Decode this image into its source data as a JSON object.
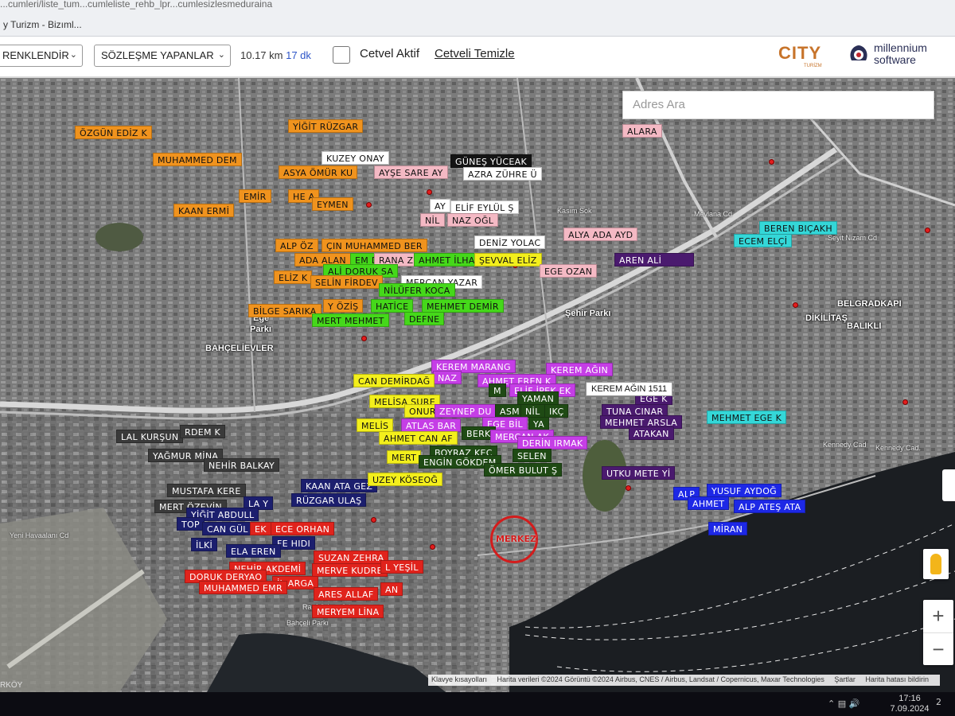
{
  "browser": {
    "url_fragment": "...cumleri/liste_tum...cumleliste_rehb_lpr...cumlesizlesmeduraina",
    "tab_title": "y Turizm - Bizıml..."
  },
  "toolbar": {
    "color_select": "RENKLENDİR",
    "filter_select": "SÖZLEŞME YAPANLAR",
    "distance": "10.17 km",
    "duration": "17 dk",
    "ruler_label": "Cetvel Aktif",
    "ruler_clear": "Cetveli Temizle",
    "logo_city": "CITY",
    "logo_city_sub": "TURİZM",
    "logo_ms_1": "millennium",
    "logo_ms_2": "software"
  },
  "map": {
    "search_placeholder": "Adres Ara",
    "merkez_label": "MERKEZ",
    "tooltip": "KEREM AĞIN 1511",
    "zoom_in": "+",
    "zoom_out": "−",
    "attribution": [
      "Klavye kısayolları",
      "Harita verileri ©2024 Görüntü ©2024 Airbus, CNES / Airbus, Landsat / Copernicus, Maxar Technologies",
      "Şartlar",
      "Harita hatası bildirin"
    ],
    "bottom_left": "RKÖY",
    "places": [
      {
        "id": "dikilitas",
        "text": "DİKİLİTAŞ"
      },
      {
        "id": "belgrad",
        "text": "BELGRADKAPI"
      },
      {
        "id": "balikli",
        "text": "BALIKLI"
      },
      {
        "id": "bahcelievler",
        "text": "BAHÇELİEVLER"
      },
      {
        "id": "sehirparki",
        "text": "Şehir Parkı"
      },
      {
        "id": "ege",
        "text": "Ege"
      },
      {
        "id": "parki",
        "text": "Parkı"
      }
    ],
    "streets": [
      {
        "id": "s1",
        "text": "Kasım Sok"
      },
      {
        "id": "s2",
        "text": "Mevlana Cd"
      },
      {
        "id": "s3",
        "text": "Seyit Nizam Cd"
      },
      {
        "id": "s4",
        "text": "Kennedy Cad"
      },
      {
        "id": "s5",
        "text": "Kennedy Cad."
      },
      {
        "id": "s6",
        "text": "Yeni Havaalanı Cd"
      },
      {
        "id": "s7",
        "text": "Rauf Orbay Cd"
      },
      {
        "id": "s8",
        "text": "Bahçeli Parkı"
      }
    ]
  },
  "colors": {
    "orange": "#f0931e",
    "yellow": "#f3ef1c",
    "green": "#45d81a",
    "magenta": "#c53ee6",
    "purple": "#4a1a6e",
    "darkgreen": "#1f4a14",
    "gray": "#3a3a3a",
    "navy": "#1c1f6e",
    "red": "#e0231c",
    "cyan": "#34d7d8",
    "blue": "#1d28e6",
    "pink": "#f4b9c4",
    "white": "#ffffff",
    "black": "#141414",
    "yellow2": "#e8e018"
  },
  "labels": [
    {
      "t": "ÖZGÜN EDİZ K",
      "c": "orange",
      "fg": "#111"
    },
    {
      "t": "YİĞİT RÜZGAR",
      "c": "orange",
      "fg": "#111"
    },
    {
      "t": "MUHAMMED DEM",
      "c": "orange",
      "fg": "#111"
    },
    {
      "t": "KUZEY ONAY",
      "c": "white",
      "fg": "#111"
    },
    {
      "t": "GÜNEŞ YÜCEAK",
      "c": "black",
      "fg": "#fff"
    },
    {
      "t": "ASYA ÖMÜR KU",
      "c": "orange",
      "fg": "#111"
    },
    {
      "t": "AYŞE SARE AY",
      "c": "pink",
      "fg": "#111"
    },
    {
      "t": "AZRA ZÜHRE Ü",
      "c": "white",
      "fg": "#111"
    },
    {
      "t": "EMİR",
      "c": "orange",
      "fg": "#111"
    },
    {
      "t": "HE   A",
      "c": "orange",
      "fg": "#111"
    },
    {
      "t": "EYMEN",
      "c": "orange",
      "fg": "#111"
    },
    {
      "t": "AY",
      "c": "white",
      "fg": "#111"
    },
    {
      "t": "ELİF EYLÜL Ş",
      "c": "white",
      "fg": "#111"
    },
    {
      "t": "KAAN ERMİ",
      "c": "orange",
      "fg": "#111"
    },
    {
      "t": "NİL",
      "c": "pink",
      "fg": "#111"
    },
    {
      "t": "NAZ  OĞL",
      "c": "pink",
      "fg": "#111"
    },
    {
      "t": "ALARA",
      "c": "pink",
      "fg": "#111"
    },
    {
      "t": "ALYA ADA AYD",
      "c": "pink",
      "fg": "#111"
    },
    {
      "t": "ALP ÖZ",
      "c": "orange",
      "fg": "#111"
    },
    {
      "t": "ÇIN MUHAMMED BER",
      "c": "orange",
      "fg": "#111"
    },
    {
      "t": "DENİZ YOLAC",
      "c": "white",
      "fg": "#111"
    },
    {
      "t": "ADA ALAN",
      "c": "orange",
      "fg": "#111"
    },
    {
      "t": "EM D",
      "c": "green",
      "fg": "#111"
    },
    {
      "t": "RANA Z",
      "c": "pink",
      "fg": "#111"
    },
    {
      "t": "AHMET İLHA",
      "c": "green",
      "fg": "#111"
    },
    {
      "t": "ŞEVVAL ELİZ",
      "c": "yellow",
      "fg": "#111"
    },
    {
      "t": "ALİ DORUK SA",
      "c": "green",
      "fg": "#111"
    },
    {
      "t": "EGE OZAN",
      "c": "pink",
      "fg": "#111"
    },
    {
      "t": "AREN ALİ",
      "c": "purple",
      "fg": "#fff"
    },
    {
      "t": "ELİZ K",
      "c": "orange",
      "fg": "#111"
    },
    {
      "t": "SELİN FİRDEV",
      "c": "orange",
      "fg": "#111"
    },
    {
      "t": "MERCAN YAZAR",
      "c": "white",
      "fg": "#111"
    },
    {
      "t": "NİLÜFER KOCA",
      "c": "green",
      "fg": "#111"
    },
    {
      "t": "BİLGE SARIKA",
      "c": "orange",
      "fg": "#111"
    },
    {
      "t": "Y ÖZİŞ",
      "c": "orange",
      "fg": "#111"
    },
    {
      "t": "HATİCE",
      "c": "green",
      "fg": "#111"
    },
    {
      "t": "MEHMET DEMİR",
      "c": "green",
      "fg": "#111"
    },
    {
      "t": "MERT MEHMET",
      "c": "green",
      "fg": "#111"
    },
    {
      "t": "DEFNE",
      "c": "green",
      "fg": "#111"
    },
    {
      "t": "BEREN BIÇAKH",
      "c": "cyan",
      "fg": "#111"
    },
    {
      "t": "ECEM ELÇİ",
      "c": "cyan",
      "fg": "#111"
    },
    {
      "t": "KEREM MARANG",
      "c": "magenta",
      "fg": "#fff"
    },
    {
      "t": "NAZ",
      "c": "magenta",
      "fg": "#fff"
    },
    {
      "t": "KEREM AĞIN",
      "c": "magenta",
      "fg": "#fff"
    },
    {
      "t": "CAN DEMİRDAĞ",
      "c": "yellow",
      "fg": "#111"
    },
    {
      "t": "AHMET EREN K",
      "c": "magenta",
      "fg": "#fff"
    },
    {
      "t": "ELİF İPEK EK",
      "c": "magenta",
      "fg": "#fff"
    },
    {
      "t": "M",
      "c": "darkgreen",
      "fg": "#fff"
    },
    {
      "t": "MELİSA SURE",
      "c": "yellow",
      "fg": "#111"
    },
    {
      "t": "ONUR",
      "c": "yellow",
      "fg": "#111"
    },
    {
      "t": "ZEYNEP DU",
      "c": "magenta",
      "fg": "#fff"
    },
    {
      "t": "ASM",
      "c": "darkgreen",
      "fg": "#fff"
    },
    {
      "t": "YAMAN",
      "c": "darkgreen",
      "fg": "#fff"
    },
    {
      "t": "NİL",
      "c": "darkgreen",
      "fg": "#fff"
    },
    {
      "t": "IKÇ",
      "c": "darkgreen",
      "fg": "#fff"
    },
    {
      "t": "EGE K",
      "c": "purple",
      "fg": "#fff"
    },
    {
      "t": "TUNA CINAR",
      "c": "purple",
      "fg": "#fff"
    },
    {
      "t": "MEHMET ARSLA",
      "c": "purple",
      "fg": "#fff"
    },
    {
      "t": "ATAKAN",
      "c": "purple",
      "fg": "#fff"
    },
    {
      "t": "MEHMET EGE K",
      "c": "cyan",
      "fg": "#111"
    },
    {
      "t": "MELİS",
      "c": "yellow",
      "fg": "#111"
    },
    {
      "t": "ATLAS BAR",
      "c": "magenta",
      "fg": "#fff"
    },
    {
      "t": "EGE BİL",
      "c": "magenta",
      "fg": "#fff"
    },
    {
      "t": "YA",
      "c": "darkgreen",
      "fg": "#fff"
    },
    {
      "t": "BERK",
      "c": "darkgreen",
      "fg": "#fff"
    },
    {
      "t": "AHMET CAN AF",
      "c": "yellow",
      "fg": "#111"
    },
    {
      "t": "MERCAN AK",
      "c": "magenta",
      "fg": "#fff"
    },
    {
      "t": "DERİN IRMAK",
      "c": "magenta",
      "fg": "#fff"
    },
    {
      "t": "LAL KURŞUN",
      "c": "gray",
      "fg": "#fff"
    },
    {
      "t": "RDEM K",
      "c": "gray",
      "fg": "#fff"
    },
    {
      "t": "YAĞMUR MİNA",
      "c": "gray",
      "fg": "#fff"
    },
    {
      "t": "NEHİR BALKAY",
      "c": "gray",
      "fg": "#fff"
    },
    {
      "t": "MERT",
      "c": "yellow",
      "fg": "#111"
    },
    {
      "t": "BOYRAZ KEÇ",
      "c": "darkgreen",
      "fg": "#fff"
    },
    {
      "t": "ENGİN GÖKDEM",
      "c": "darkgreen",
      "fg": "#fff"
    },
    {
      "t": "SELEN",
      "c": "darkgreen",
      "fg": "#fff"
    },
    {
      "t": "ÖMER BULUT Ş",
      "c": "darkgreen",
      "fg": "#fff"
    },
    {
      "t": "UTKU METE Yİ",
      "c": "purple",
      "fg": "#fff"
    },
    {
      "t": "MUSTAFA KERE",
      "c": "gray",
      "fg": "#fff"
    },
    {
      "t": "KAAN ATA GEZ",
      "c": "navy",
      "fg": "#fff"
    },
    {
      "t": "UZEY KÖSEOĞ",
      "c": "yellow",
      "fg": "#111"
    },
    {
      "t": "ALP",
      "c": "blue",
      "fg": "#fff"
    },
    {
      "t": "YUSUF AYDOĞ",
      "c": "blue",
      "fg": "#fff"
    },
    {
      "t": "AHMET",
      "c": "blue",
      "fg": "#fff"
    },
    {
      "t": "ALP ATEŞ ATA",
      "c": "blue",
      "fg": "#fff"
    },
    {
      "t": "MERT ÖZEVİN",
      "c": "gray",
      "fg": "#fff"
    },
    {
      "t": "LA Y",
      "c": "navy",
      "fg": "#fff"
    },
    {
      "t": "RÜZGAR ULAŞ",
      "c": "navy",
      "fg": "#fff"
    },
    {
      "t": "YİĞİT ABDULL",
      "c": "navy",
      "fg": "#fff"
    },
    {
      "t": "TOP",
      "c": "navy",
      "fg": "#fff"
    },
    {
      "t": "CAN GÜL",
      "c": "navy",
      "fg": "#fff"
    },
    {
      "t": "EK",
      "c": "red",
      "fg": "#fff"
    },
    {
      "t": "ECE ORHAN",
      "c": "red",
      "fg": "#fff"
    },
    {
      "t": "MİRAN",
      "c": "blue",
      "fg": "#fff"
    },
    {
      "t": "İLKİ",
      "c": "navy",
      "fg": "#fff"
    },
    {
      "t": "FE HIDI",
      "c": "navy",
      "fg": "#fff"
    },
    {
      "t": "ELA EREN",
      "c": "navy",
      "fg": "#fff"
    },
    {
      "t": "SUZAN ZEHRA",
      "c": "red",
      "fg": "#fff"
    },
    {
      "t": "NEHİR AKDEMİ",
      "c": "red",
      "fg": "#fff"
    },
    {
      "t": "MERVE KUDRE",
      "c": "red",
      "fg": "#fff"
    },
    {
      "t": "L YEŞİL",
      "c": "red",
      "fg": "#fff"
    },
    {
      "t": "DORUK DERYAO",
      "c": "red",
      "fg": "#fff"
    },
    {
      "t": "İL ARGA",
      "c": "red",
      "fg": "#fff"
    },
    {
      "t": "MUHAMMED EMR",
      "c": "red",
      "fg": "#fff"
    },
    {
      "t": "ARES ALLAF",
      "c": "red",
      "fg": "#fff"
    },
    {
      "t": "AN",
      "c": "red",
      "fg": "#fff"
    },
    {
      "t": "MERYEM LİNA",
      "c": "red",
      "fg": "#fff"
    }
  ],
  "taskbar": {
    "time": "17:16",
    "date": "7.09.2024",
    "notifications": "2"
  }
}
